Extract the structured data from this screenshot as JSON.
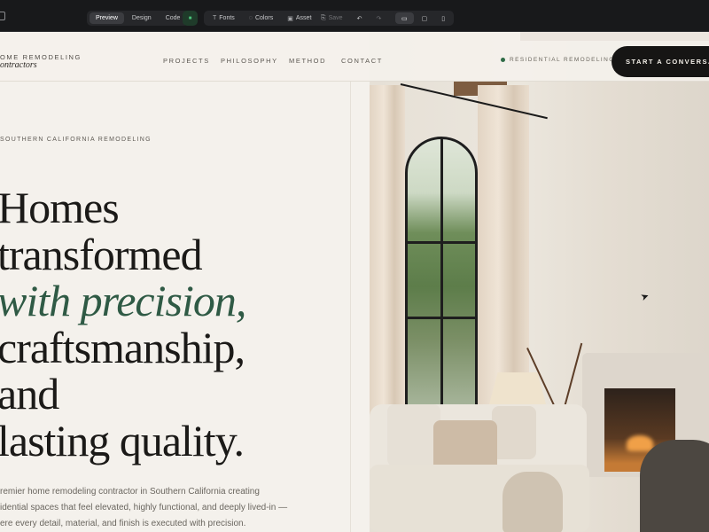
{
  "editor_toolbar": {
    "view_tabs": [
      "Preview",
      "Design",
      "Code"
    ],
    "active_tab": "Preview",
    "tools": [
      {
        "label": "Fonts",
        "icon": "text-icon"
      },
      {
        "label": "Colors",
        "icon": "palette-icon"
      },
      {
        "label": "Assets",
        "icon": "assets-icon"
      }
    ],
    "save_label": "Save",
    "device_icons": [
      "desktop-icon",
      "tablet-icon",
      "mobile-icon"
    ]
  },
  "nav": {
    "brand_top": "OME REMODELING",
    "brand_bottom": "ontractors",
    "links": [
      "PROJECTS",
      "PHILOSOPHY",
      "METHOD",
      "CONTACT"
    ],
    "status_text": "RESIDENTIAL REMODELING",
    "cta_label": "START A CONVERSATI"
  },
  "hero": {
    "eyebrow": "SOUTHERN CALIFORNIA REMODELING",
    "headline_lines": [
      {
        "text": "Homes",
        "accent": false
      },
      {
        "text": "transformed",
        "accent": false
      },
      {
        "text": "with precision,",
        "accent": true
      },
      {
        "text": "craftsmanship,",
        "accent": false
      },
      {
        "text": "and",
        "accent": false
      },
      {
        "text": "lasting quality.",
        "accent": false
      }
    ],
    "body_lines": [
      "remier home remodeling contractor in Southern California creating",
      "idential spaces that feel elevated, highly functional, and deeply lived-in —",
      "ere every detail, material, and finish is executed with precision."
    ]
  },
  "colors": {
    "page_bg": "#f4f1ec",
    "accent_green": "#2f5a45",
    "cta_bg": "#161514"
  }
}
